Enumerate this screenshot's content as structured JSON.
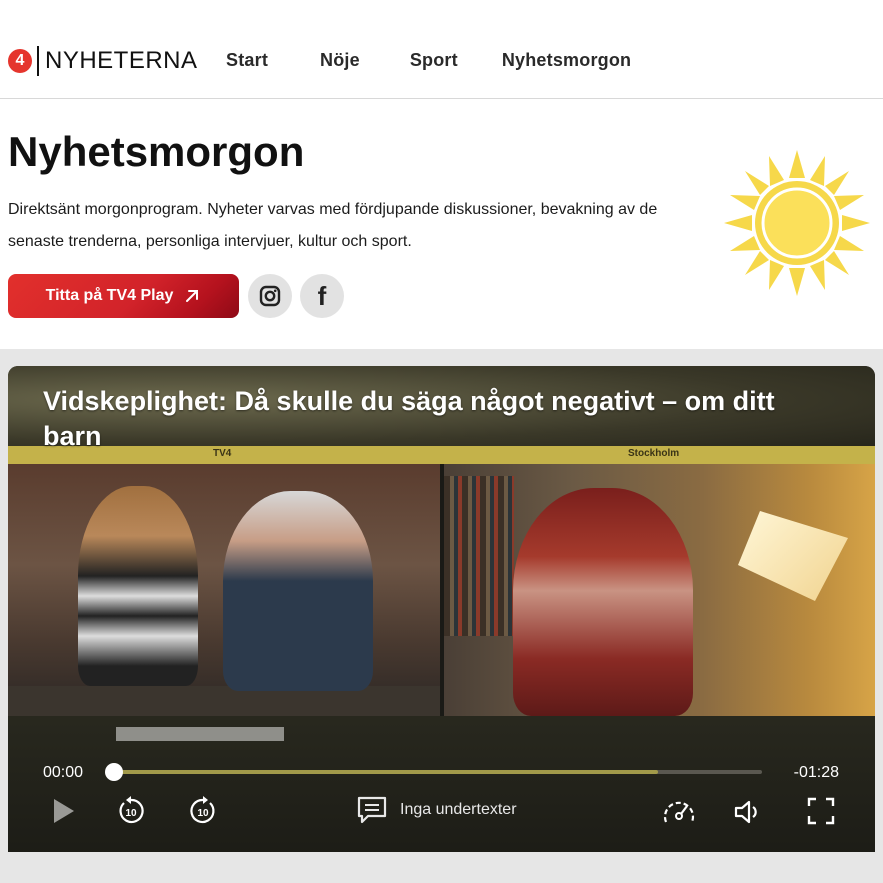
{
  "header": {
    "logo_badge": "4",
    "logo_text": "NYHETERNA",
    "nav": [
      "Start",
      "Nöje",
      "Sport",
      "Nyhetsmorgon"
    ]
  },
  "intro": {
    "title": "Nyhetsmorgon",
    "description": "Direktsänt morgonprogram. Nyheter varvas med fördjupande diskussioner, bevakning av de senaste trenderna, personliga intervjuer, kultur och sport.",
    "cta_label": "Titta på TV4 Play",
    "cta_icon": "arrow-up-right-icon",
    "social": [
      "instagram-icon",
      "facebook-icon"
    ]
  },
  "video": {
    "title": "Vidskeplighet: Då skulle du säga något negativt – om ditt barn",
    "frame_label_left": "TV4",
    "frame_label_right": "Stockholm",
    "player": {
      "current_time": "00:00",
      "remaining_time": "-01:28",
      "buffered_fraction": 0.84,
      "played_fraction": 0.0,
      "subtitles_label": "Inga undertexter"
    }
  },
  "colors": {
    "accent_red": "#e2302c",
    "sun_yellow": "#f6d84a",
    "progress_gold": "#a29a4a"
  }
}
